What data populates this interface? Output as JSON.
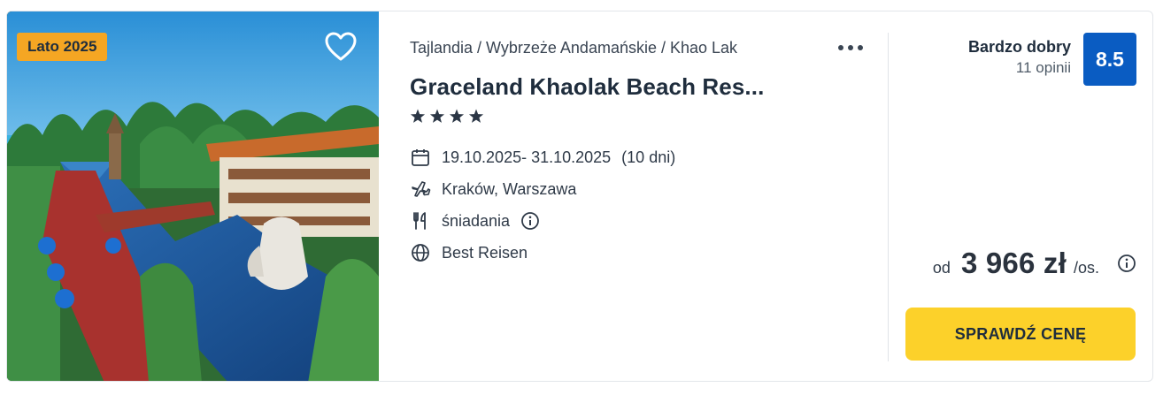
{
  "offer": {
    "badge": "Lato 2025",
    "breadcrumb": "Tajlandia / Wybrzeże Andamańskie / Khao Lak",
    "title": "Graceland Khaolak Beach Res...",
    "stars": 4,
    "dates": "19.10.2025- 31.10.2025",
    "duration": "(10 dni)",
    "departure": "Kraków, Warszawa",
    "board": "śniadania",
    "operator": "Best Reisen"
  },
  "rating": {
    "label": "Bardzo dobry",
    "reviews": "11 opinii",
    "score": "8.5"
  },
  "price": {
    "from": "od",
    "amount": "3 966 zł",
    "per": "/os."
  },
  "cta": {
    "label": "SPRAWDŹ CENĘ"
  },
  "colors": {
    "badge": "#f5a623",
    "score_bg": "#0a5cc2",
    "cta_bg": "#fcd12a",
    "text_dark": "#1f2d3d"
  },
  "icons": {
    "favorite": "heart-icon",
    "more": "more-dots-icon",
    "dates": "calendar-icon",
    "departure": "plane-icon",
    "board": "cutlery-icon",
    "board_info": "info-icon",
    "operator": "globe-icon",
    "price_info": "info-icon"
  }
}
